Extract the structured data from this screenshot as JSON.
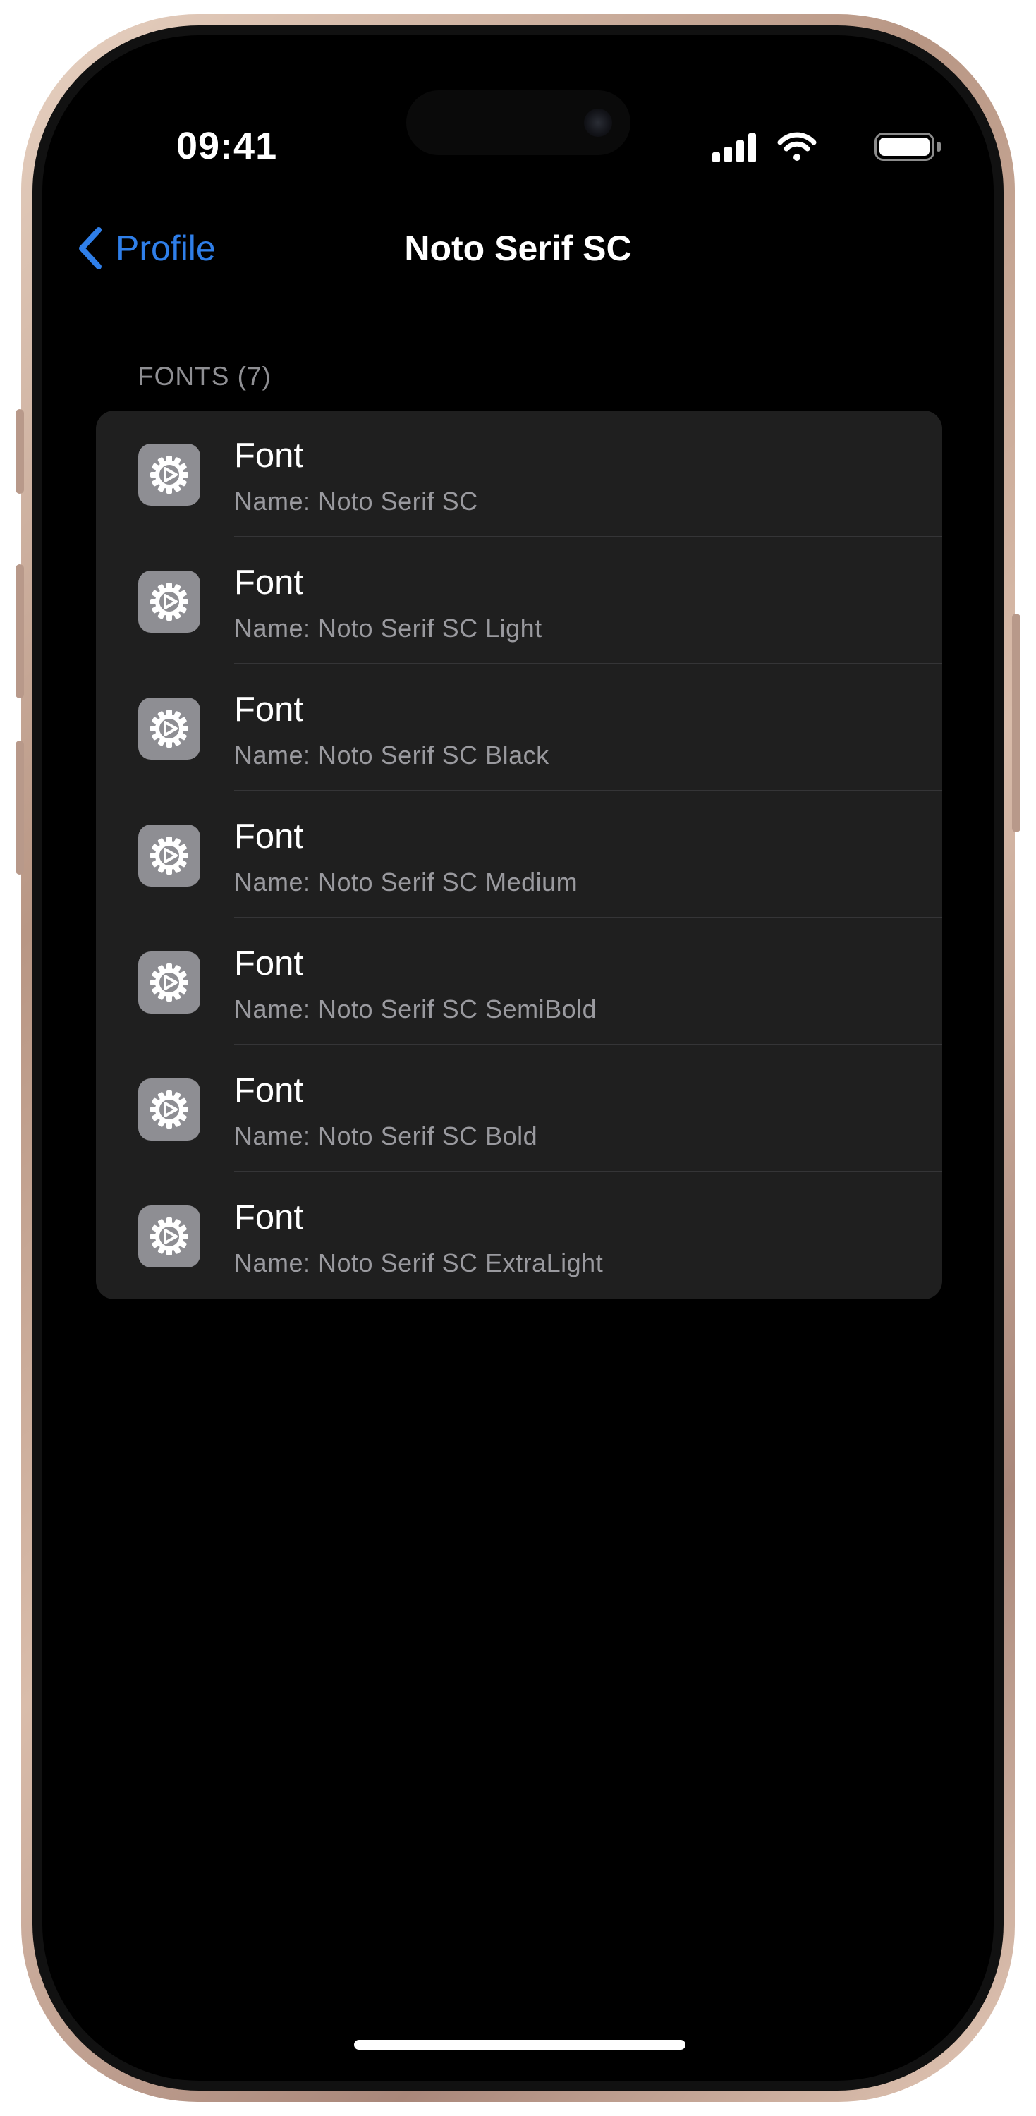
{
  "status_bar": {
    "time": "09:41",
    "icons": [
      "cellular-signal-icon",
      "wifi-icon",
      "battery-icon"
    ]
  },
  "nav": {
    "back_label": "Profile",
    "title": "Noto Serif SC"
  },
  "section": {
    "header": "FONTS (7)"
  },
  "fonts": [
    {
      "title": "Font",
      "subtitle": "Name: Noto Serif SC"
    },
    {
      "title": "Font",
      "subtitle": "Name: Noto Serif SC Light"
    },
    {
      "title": "Font",
      "subtitle": "Name: Noto Serif SC Black"
    },
    {
      "title": "Font",
      "subtitle": "Name: Noto Serif SC Medium"
    },
    {
      "title": "Font",
      "subtitle": "Name: Noto Serif SC SemiBold"
    },
    {
      "title": "Font",
      "subtitle": "Name: Noto Serif SC Bold"
    },
    {
      "title": "Font",
      "subtitle": "Name: Noto Serif SC ExtraLight"
    }
  ],
  "colors": {
    "accent": "#2f7fea",
    "background": "#000000",
    "list_background": "#1f1f1f",
    "icon_tile": "#8e8e93",
    "secondary_text": "#9a9a9f"
  },
  "row_icon": "settings-gear-icon"
}
